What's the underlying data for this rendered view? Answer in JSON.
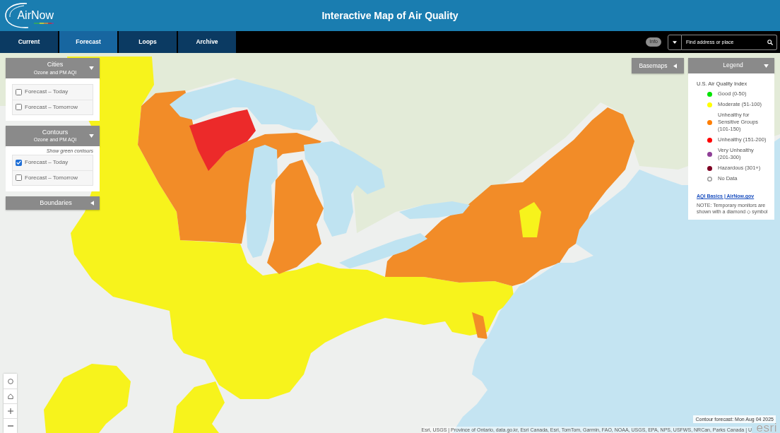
{
  "header": {
    "logo": "AirNow",
    "title": "Interactive Map of Air Quality"
  },
  "tabs": [
    {
      "label": "Current",
      "selected": false
    },
    {
      "label": "Forecast",
      "selected": true
    },
    {
      "label": "Loops",
      "selected": false
    },
    {
      "label": "Archive",
      "selected": false
    }
  ],
  "toolbar": {
    "info_button": "Info",
    "search": {
      "placeholder": "Find address or place"
    }
  },
  "left_panels": [
    {
      "title": "Cities",
      "subtitle": "Ozone and PM AQI",
      "expanded": true,
      "options": [
        {
          "label": "Forecast – Today",
          "checked": false
        },
        {
          "label": "Forecast – Tomorrow",
          "checked": false
        }
      ]
    },
    {
      "title": "Contours",
      "subtitle": "Ozone and PM AQI",
      "expanded": true,
      "note": "Show green contours",
      "options": [
        {
          "label": "Forecast – Today",
          "checked": true
        },
        {
          "label": "Forecast – Tomorrow",
          "checked": false
        }
      ]
    },
    {
      "title": "Boundaries",
      "expanded": false
    }
  ],
  "basemaps": {
    "title": "Basemaps",
    "expanded": false
  },
  "legend": {
    "title": "Legend",
    "expanded": true,
    "heading": "U.S. Air Quality Index",
    "items": [
      {
        "label": "Good (0-50)",
        "kind": "dot",
        "color": "#00e400"
      },
      {
        "label": "Moderate (51-100)",
        "kind": "dot",
        "color": "#ffff00"
      },
      {
        "label": "Unhealthy for Sensitive Groups (101-150)",
        "kind": "dot",
        "color": "#ff7e00"
      },
      {
        "label": "Unhealthy (151-200)",
        "kind": "dot",
        "color": "#ff0000"
      },
      {
        "label": "Very Unhealthy (201-300)",
        "kind": "dot",
        "color": "#8f3f97"
      },
      {
        "label": "Hazardous (301+)",
        "kind": "dot",
        "color": "#7e0023"
      },
      {
        "label": "No Data",
        "kind": "ring",
        "color": "#999999"
      }
    ],
    "link": "AQI Basics | AirNow.gov",
    "note": "NOTE: Temporary monitors are shown with a diamond ◇ symbol"
  },
  "map": {
    "areas": [
      {
        "color": "#f7f31c"
      },
      {
        "color": "#f28c28"
      },
      {
        "color": "#ec2a2a"
      },
      {
        "color": "#f28c28"
      },
      {
        "color": "#f28c28"
      },
      {
        "color": "#f7f31c"
      },
      {
        "color": "#f28c28"
      },
      {
        "color": "#f7f31c"
      },
      {
        "color": "#f7f31c"
      }
    ],
    "contour_date": "Contour forecast: Mon Aug 04 2025",
    "attribution": "Esri, USGS | Province of Ontario, data.go.kr, Esri Canada, Esri, TomTom, Garmin, FAO, NOAA, USGS, EPA, NPS, USFWS, NRCan, Parks Canada | U",
    "logo": "esri"
  }
}
